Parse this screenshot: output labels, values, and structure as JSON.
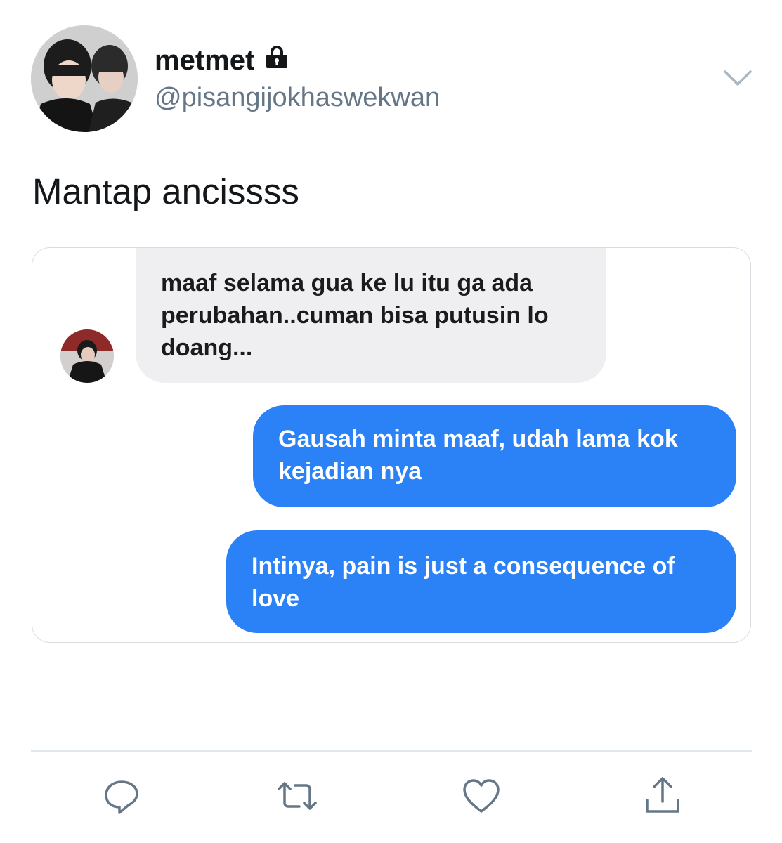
{
  "tweet": {
    "display_name": "metmet",
    "handle": "@pisangijokhaswekwan",
    "protected_icon": "lock-icon",
    "text": "Mantap ancissss"
  },
  "chat": {
    "messages": [
      {
        "direction": "incoming",
        "text": "maaf selama gua ke lu itu ga ada perubahan..cuman bisa putusin lo doang..."
      },
      {
        "direction": "outgoing",
        "text": "Gausah minta maaf, udah lama kok kejadian nya"
      },
      {
        "direction": "outgoing",
        "text": "Intinya, pain is just a consequence of love"
      }
    ],
    "colors": {
      "incoming_bubble": "#efeff1",
      "outgoing_bubble": "#2a82f6"
    }
  },
  "actions": {
    "icons": [
      "reply-icon",
      "retweet-icon",
      "like-icon",
      "share-icon"
    ]
  },
  "colors": {
    "secondary_text": "#657786",
    "divider": "#e1e8ed"
  }
}
